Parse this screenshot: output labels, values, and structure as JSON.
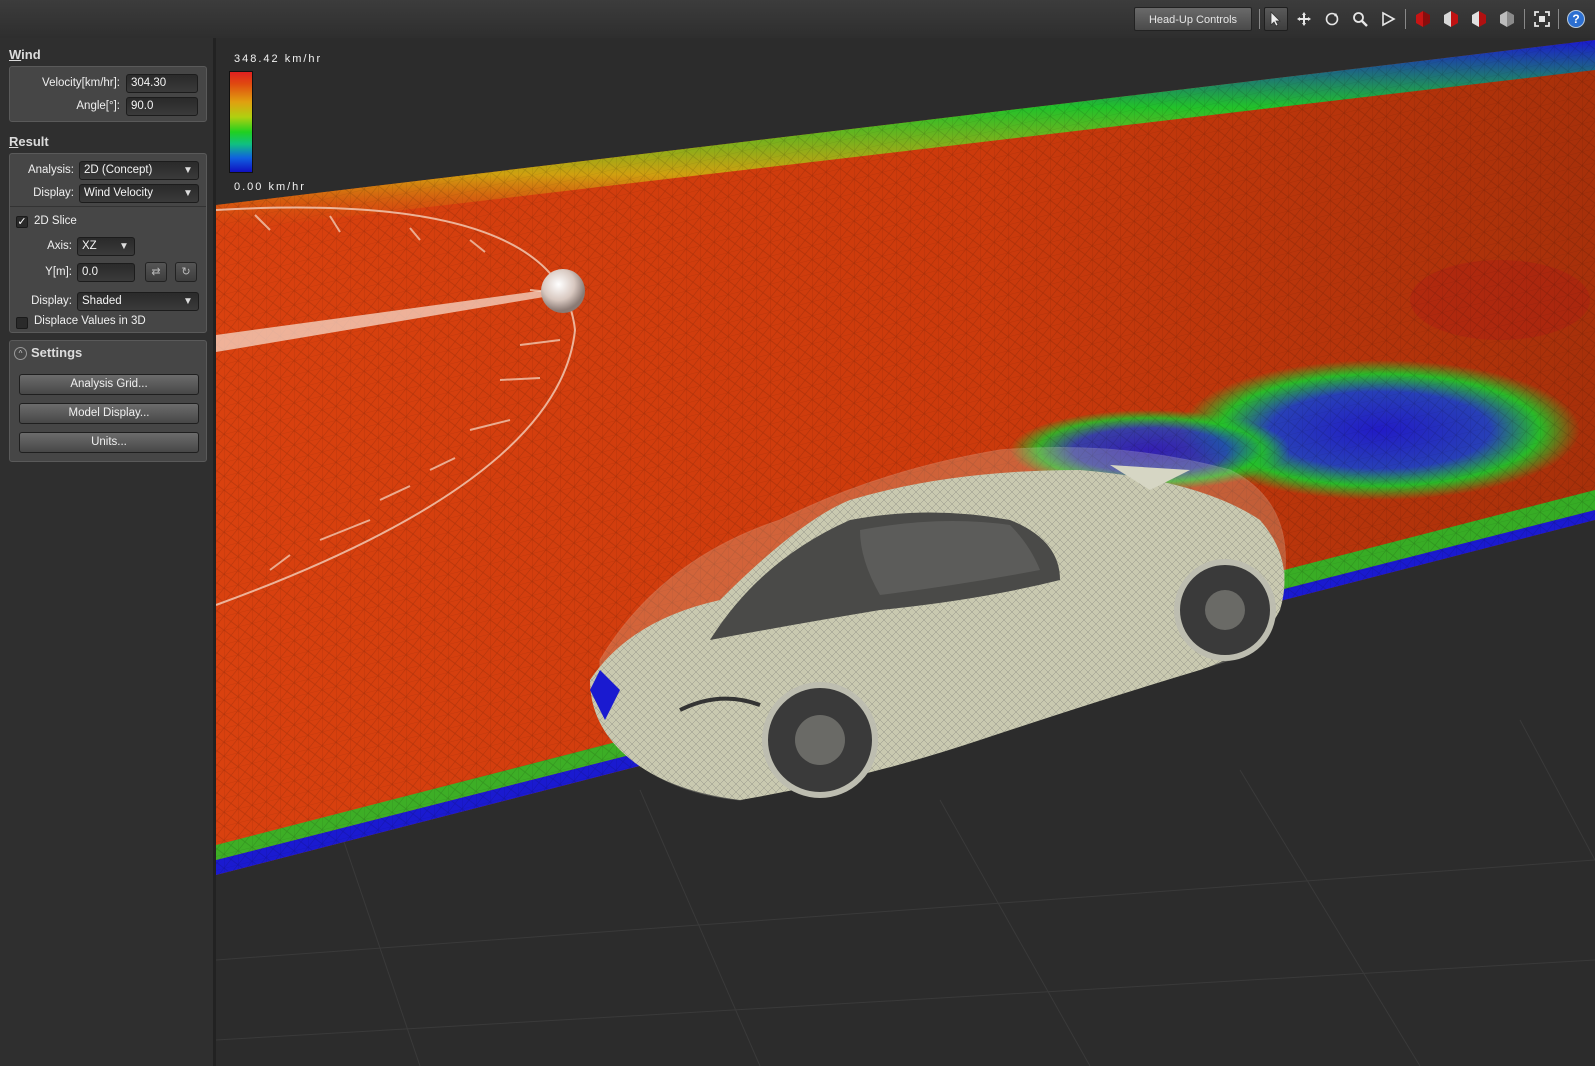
{
  "toolbar": {
    "hud_label": "Head-Up Controls",
    "icons": [
      "select-arrow-icon",
      "pan-icon",
      "rotate-icon",
      "zoom-icon",
      "play-icon",
      "red-cube-icon",
      "red-cube-half-icon",
      "cube-outline-icon",
      "cube-gray-icon",
      "fit-view-icon",
      "help-icon"
    ],
    "help_glyph": "?"
  },
  "wind": {
    "title_first": "W",
    "title_rest": "ind",
    "velocity_label": "Velocity[km/hr]:",
    "velocity_value": "304.30",
    "angle_label": "Angle[°]:",
    "angle_value": "90.0"
  },
  "result": {
    "title_first": "R",
    "title_rest": "esult",
    "analysis_label": "Analysis:",
    "analysis_value": "2D (Concept)",
    "display_label": "Display:",
    "display_value": "Wind Velocity",
    "slice_label": "2D Slice",
    "slice_checked": true,
    "axis_label": "Axis:",
    "axis_value": "XZ",
    "y_label": "Y[m]:",
    "y_value": "0.0",
    "display2_label": "Display:",
    "display2_value": "Shaded",
    "displace_label": "Displace Values in 3D",
    "displace_checked": false
  },
  "settings": {
    "title": "Settings",
    "buttons": [
      "Analysis Grid...",
      "Model Display...",
      "Units..."
    ]
  },
  "legend": {
    "max_label": "348.42 km/hr",
    "min_label": "0.00 km/hr"
  },
  "colors": {
    "flow_high": "#d9410f",
    "flow_low": "#1a1ad0",
    "flow_mid": "#22c22a",
    "accent": "#2c6fd1"
  }
}
